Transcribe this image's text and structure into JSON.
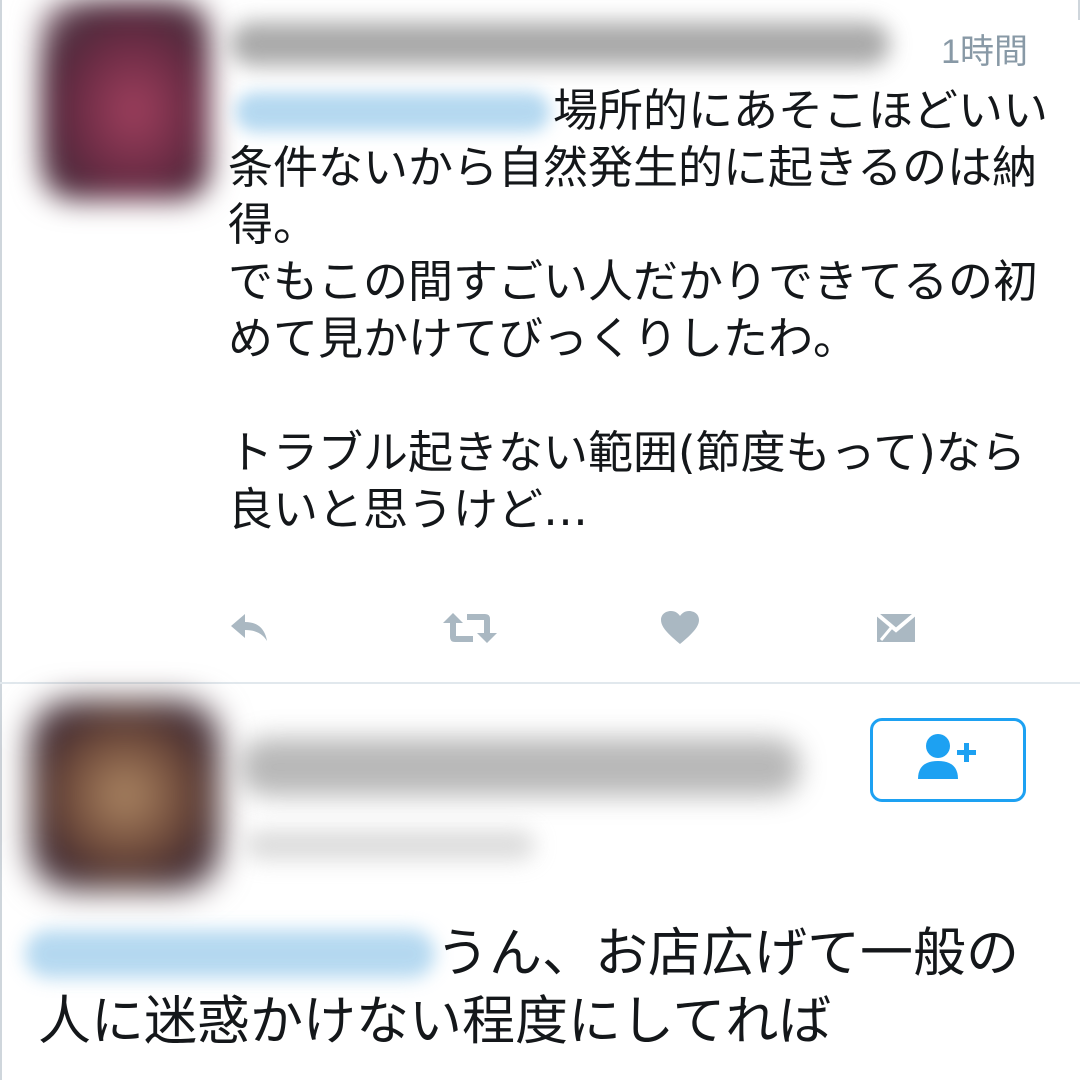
{
  "tweet1": {
    "time": "1時間",
    "text": "場所的にあそこほどいい条件ないから自然発生的に起きるのは納得。\nでもこの間すごい人だかりできてるの初めて見かけてびっくりしたわ。\n\nトラブル起きない範囲(節度もって)なら良いと思うけど…"
  },
  "tweet2": {
    "text": "うん、お店広げて一般の人に迷惑かけない程度にしてれば"
  },
  "icons": {
    "reply": "reply-icon",
    "retweet": "retweet-icon",
    "like": "heart-icon",
    "dm": "envelope-icon",
    "follow": "add-user-icon"
  },
  "colors": {
    "action_icon": "#aab8c2",
    "accent": "#1da1f2",
    "timestamp": "#8899a6",
    "divider": "#e1e8ed"
  }
}
